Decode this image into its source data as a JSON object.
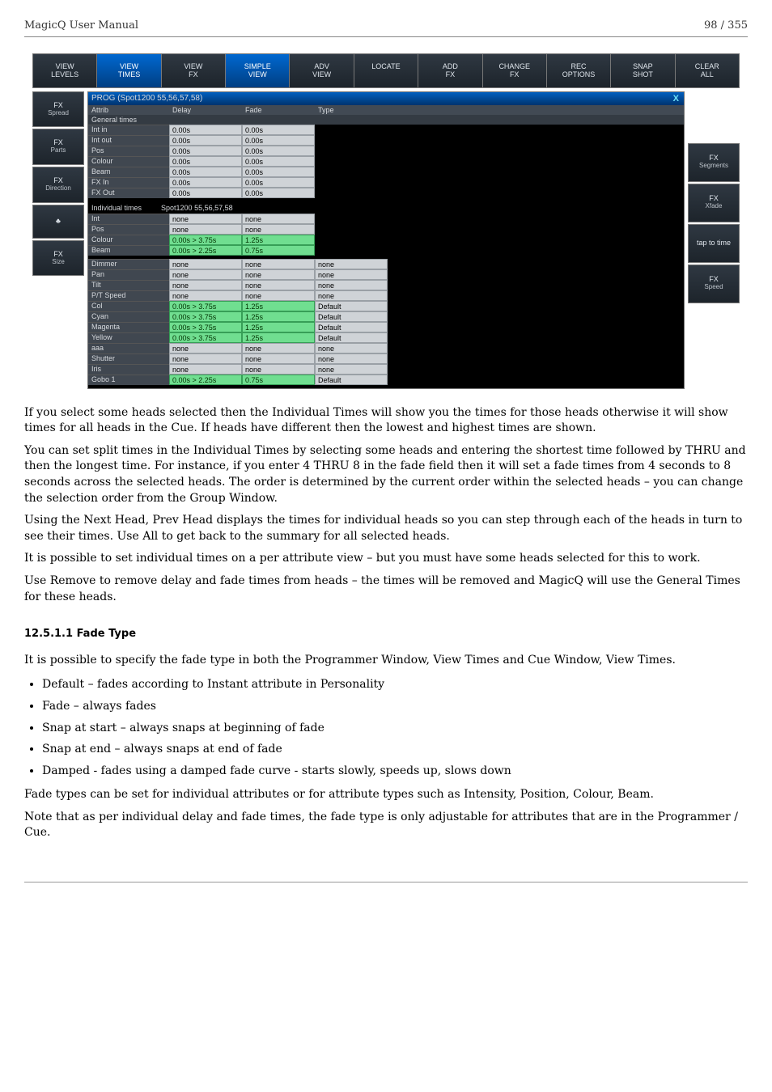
{
  "header": {
    "title": "MagicQ User Manual",
    "page": "98 / 355"
  },
  "mq": {
    "topbuttons": [
      {
        "label": "VIEW\nLEVELS",
        "sel": false
      },
      {
        "label": "VIEW\nTIMES",
        "sel": true
      },
      {
        "label": "VIEW\nFX",
        "sel": false
      },
      {
        "label": "SIMPLE\nVIEW",
        "sel": true
      },
      {
        "label": "ADV\nVIEW",
        "sel": false
      },
      {
        "label": "LOCATE",
        "sel": false
      },
      {
        "label": "ADD\nFX",
        "sel": false
      },
      {
        "label": "CHANGE\nFX",
        "sel": false
      },
      {
        "label": "REC\nOPTIONS",
        "sel": false
      },
      {
        "label": "SNAP\nSHOT",
        "sel": false
      },
      {
        "label": "CLEAR\nALL",
        "sel": false
      }
    ],
    "leftbuttons": [
      {
        "ln1": "FX",
        "ln2": "Spread"
      },
      {
        "ln1": "FX",
        "ln2": "Parts"
      },
      {
        "ln1": "FX",
        "ln2": "Direction"
      },
      {
        "ln1": "♣",
        "ln2": ""
      },
      {
        "ln1": "FX",
        "ln2": "Size"
      }
    ],
    "rightbuttons": [
      {
        "ln1": "FX",
        "ln2": "Segments"
      },
      {
        "ln1": "FX",
        "ln2": "Xfade"
      },
      {
        "ln1": "tap to time",
        "ln2": ""
      },
      {
        "ln1": "FX",
        "ln2": "Speed"
      }
    ],
    "progtitle": "PROG (Spot1200 55,56,57,58)",
    "colheads": {
      "c1": "Attrib",
      "c2": "Delay",
      "c3": "Fade",
      "c4": "Type"
    },
    "general_header": "General times",
    "general_rows": [
      {
        "name": "Int in",
        "delay": "0.00s",
        "fade": "0.00s"
      },
      {
        "name": "Int out",
        "delay": "0.00s",
        "fade": "0.00s"
      },
      {
        "name": "Pos",
        "delay": "0.00s",
        "fade": "0.00s"
      },
      {
        "name": "Colour",
        "delay": "0.00s",
        "fade": "0.00s"
      },
      {
        "name": "Beam",
        "delay": "0.00s",
        "fade": "0.00s"
      },
      {
        "name": "FX In",
        "delay": "0.00s",
        "fade": "0.00s"
      },
      {
        "name": "FX Out",
        "delay": "0.00s",
        "fade": "0.00s"
      }
    ],
    "indiv_header": {
      "label": "Individual times",
      "heads": "Spot1200 55,56,57,58"
    },
    "indiv_a": [
      {
        "name": "Int",
        "delay": "none",
        "fade": "none"
      },
      {
        "name": "Pos",
        "delay": "none",
        "fade": "none"
      },
      {
        "name": "Colour",
        "delay": "0.00s > 3.75s",
        "fade": "1.25s",
        "dg": true
      },
      {
        "name": "Beam",
        "delay": "0.00s > 2.25s",
        "fade": "0.75s",
        "dg": true
      }
    ],
    "indiv_b": [
      {
        "name": "Dimmer",
        "delay": "none",
        "fade": "none",
        "type": "none"
      },
      {
        "name": "Pan",
        "delay": "none",
        "fade": "none",
        "type": "none"
      },
      {
        "name": "Tilt",
        "delay": "none",
        "fade": "none",
        "type": "none"
      },
      {
        "name": "P/T Speed",
        "delay": "none",
        "fade": "none",
        "type": "none"
      },
      {
        "name": "Col",
        "delay": "0.00s > 3.75s",
        "fade": "1.25s",
        "type": "Default",
        "dg": true
      },
      {
        "name": "Cyan",
        "delay": "0.00s > 3.75s",
        "fade": "1.25s",
        "type": "Default",
        "dg": true
      },
      {
        "name": "Magenta",
        "delay": "0.00s > 3.75s",
        "fade": "1.25s",
        "type": "Default",
        "dg": true
      },
      {
        "name": "Yellow",
        "delay": "0.00s > 3.75s",
        "fade": "1.25s",
        "type": "Default",
        "dg": true
      },
      {
        "name": "aaa",
        "delay": "none",
        "fade": "none",
        "type": "none"
      },
      {
        "name": "Shutter",
        "delay": "none",
        "fade": "none",
        "type": "none"
      },
      {
        "name": "Iris",
        "delay": "none",
        "fade": "none",
        "type": "none"
      },
      {
        "name": "Gobo 1",
        "delay": "0.00s > 2.25s",
        "fade": "0.75s",
        "type": "Default",
        "dg": true
      }
    ]
  },
  "body": {
    "p1": "If you select some heads selected then the Individual Times will show you the times for those heads otherwise it will show times for all heads in the Cue. If heads have different then the lowest and highest times are shown.",
    "p2": "You can set split times in the Individual Times by selecting some heads and entering the shortest time followed by THRU and then the longest time. For instance, if you enter 4 THRU 8 in the fade field then it will set a fade times from 4 seconds to 8 seconds across the selected heads. The order is determined by the current order within the selected heads – you can change the selection order from the Group Window.",
    "p3": "Using the Next Head, Prev Head displays the times for individual heads so you can step through each of the heads in turn to see their times. Use All to get back to the summary for all selected heads.",
    "p4": "It is possible to set individual times on a per attribute view – but you must have some heads selected for this to work.",
    "p5": "Use Remove to remove delay and fade times from heads – the times will be removed and MagicQ will use the General Times for these heads.",
    "h4": "12.5.1.1   Fade Type",
    "p6": "It is possible to specify the fade type in both the Programmer Window, View Times and Cue Window, View Times.",
    "bullets": [
      "Default – fades according to Instant attribute in Personality",
      "Fade – always fades",
      "Snap at start – always snaps at beginning of fade",
      "Snap at end – always snaps at end of fade",
      "Damped - fades using a damped fade curve - starts slowly, speeds up, slows down"
    ],
    "p7": "Fade types can be set for individual attributes or for attribute types such as Intensity, Position, Colour, Beam.",
    "p8": "Note that as per individual delay and fade times, the fade type is only adjustable for attributes that are in the Programmer / Cue."
  }
}
